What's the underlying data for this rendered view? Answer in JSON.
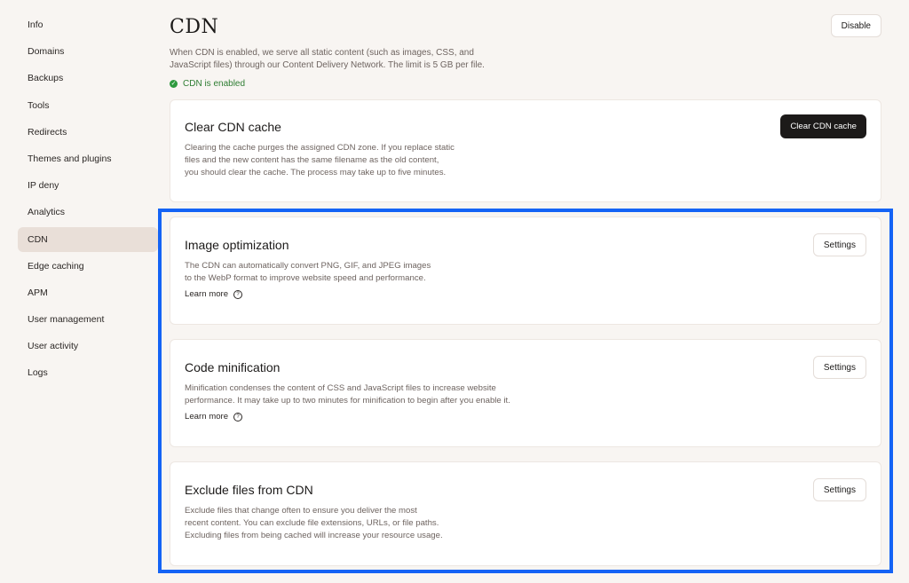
{
  "sidebar": {
    "items": [
      {
        "label": "Info"
      },
      {
        "label": "Domains"
      },
      {
        "label": "Backups"
      },
      {
        "label": "Tools"
      },
      {
        "label": "Redirects"
      },
      {
        "label": "Themes and plugins"
      },
      {
        "label": "IP deny"
      },
      {
        "label": "Analytics"
      },
      {
        "label": "CDN",
        "active": true
      },
      {
        "label": "Edge caching"
      },
      {
        "label": "APM"
      },
      {
        "label": "User management"
      },
      {
        "label": "User activity"
      },
      {
        "label": "Logs"
      }
    ]
  },
  "header": {
    "title": "CDN",
    "disable_label": "Disable",
    "intro_line1": "When CDN is enabled, we serve all static content (such as images, CSS, and",
    "intro_line2": "JavaScript files) through our Content Delivery Network. The limit is 5 GB per file.",
    "status": "CDN is enabled",
    "status_color": "#2e9a3e"
  },
  "cards": {
    "clear_cache": {
      "title": "Clear CDN cache",
      "button": "Clear CDN cache",
      "desc1": "Clearing the cache purges the assigned CDN zone. If you replace static",
      "desc2": "files and the new content has the same filename as the old content,",
      "desc3": "you should clear the cache. The process may take up to five minutes."
    },
    "image_opt": {
      "title": "Image optimization",
      "button": "Settings",
      "desc1": "The CDN can automatically convert PNG, GIF, and JPEG images",
      "desc2": "to the WebP format to improve website speed and performance.",
      "learn_more": "Learn more"
    },
    "code_min": {
      "title": "Code minification",
      "button": "Settings",
      "desc1": "Minification condenses the content of CSS and JavaScript files to increase website",
      "desc2": "performance. It may take up to two minutes for minification to begin after you enable it.",
      "learn_more": "Learn more"
    },
    "exclude": {
      "title": "Exclude files from CDN",
      "button": "Settings",
      "desc1": "Exclude files that change often to ensure you deliver the most",
      "desc2": "recent content. You can exclude file extensions, URLs, or file paths.",
      "desc3": "Excluding files from being cached will increase your resource usage."
    }
  },
  "colors": {
    "highlight": "#1463f5",
    "background": "#f8f5f2",
    "active_nav": "#e9dfd8"
  }
}
